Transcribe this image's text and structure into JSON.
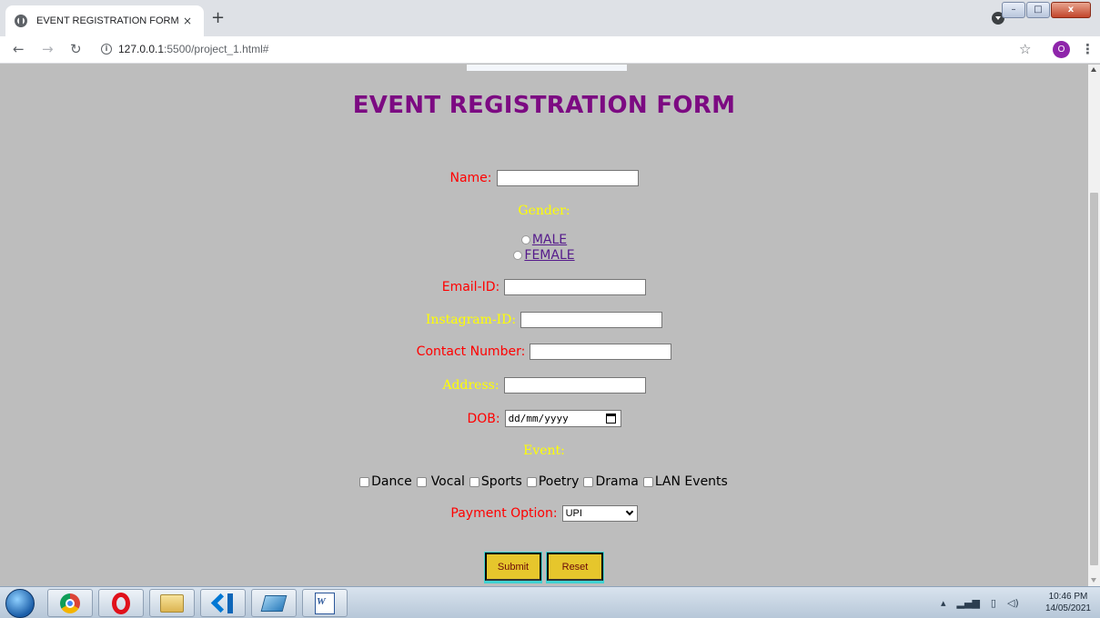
{
  "browser": {
    "tab_title": "EVENT REGISTRATION FORM",
    "tab_close": "×",
    "new_tab": "+",
    "url_host": "127.0.0.1",
    "url_rest": ":5500/project_1.html#",
    "profile_initial": "O",
    "window_controls": {
      "minimize": "–",
      "maximize": "□",
      "close": "x"
    }
  },
  "form": {
    "title": "EVENT REGISTRATION FORM",
    "name_label": "Name:",
    "gender_label": "Gender:",
    "gender_options": [
      "MALE",
      "FEMALE"
    ],
    "email_label": "Email-ID:",
    "instagram_label": "Instagram-ID:",
    "contact_label": "Contact Number:",
    "address_label": "Address:",
    "dob_label": "DOB:",
    "dob_placeholder": "dd/mm/yyyy",
    "event_label": "Event:",
    "events": [
      "Dance",
      "Vocal",
      "Sports",
      "Poetry",
      "Drama",
      "LAN Events"
    ],
    "payment_label": "Payment Option:",
    "payment_selected": "UPI",
    "submit_label": "Submit",
    "reset_label": "Reset"
  },
  "taskbar": {
    "time": "10:46 PM",
    "date": "14/05/2021"
  },
  "colors": {
    "page_bg": "#bdbdbd",
    "title": "#7c0a82",
    "label_red": "#ff0000",
    "label_yellow": "#ffff00",
    "button_bg": "#e6c62c",
    "button_outline": "#41d3d3",
    "link": "#551a8b"
  },
  "icons": [
    "globe-icon",
    "back-arrow-icon",
    "forward-arrow-icon",
    "reload-icon",
    "info-icon",
    "star-icon",
    "kebab-menu-icon",
    "calendar-icon",
    "chevron-down-icon"
  ]
}
